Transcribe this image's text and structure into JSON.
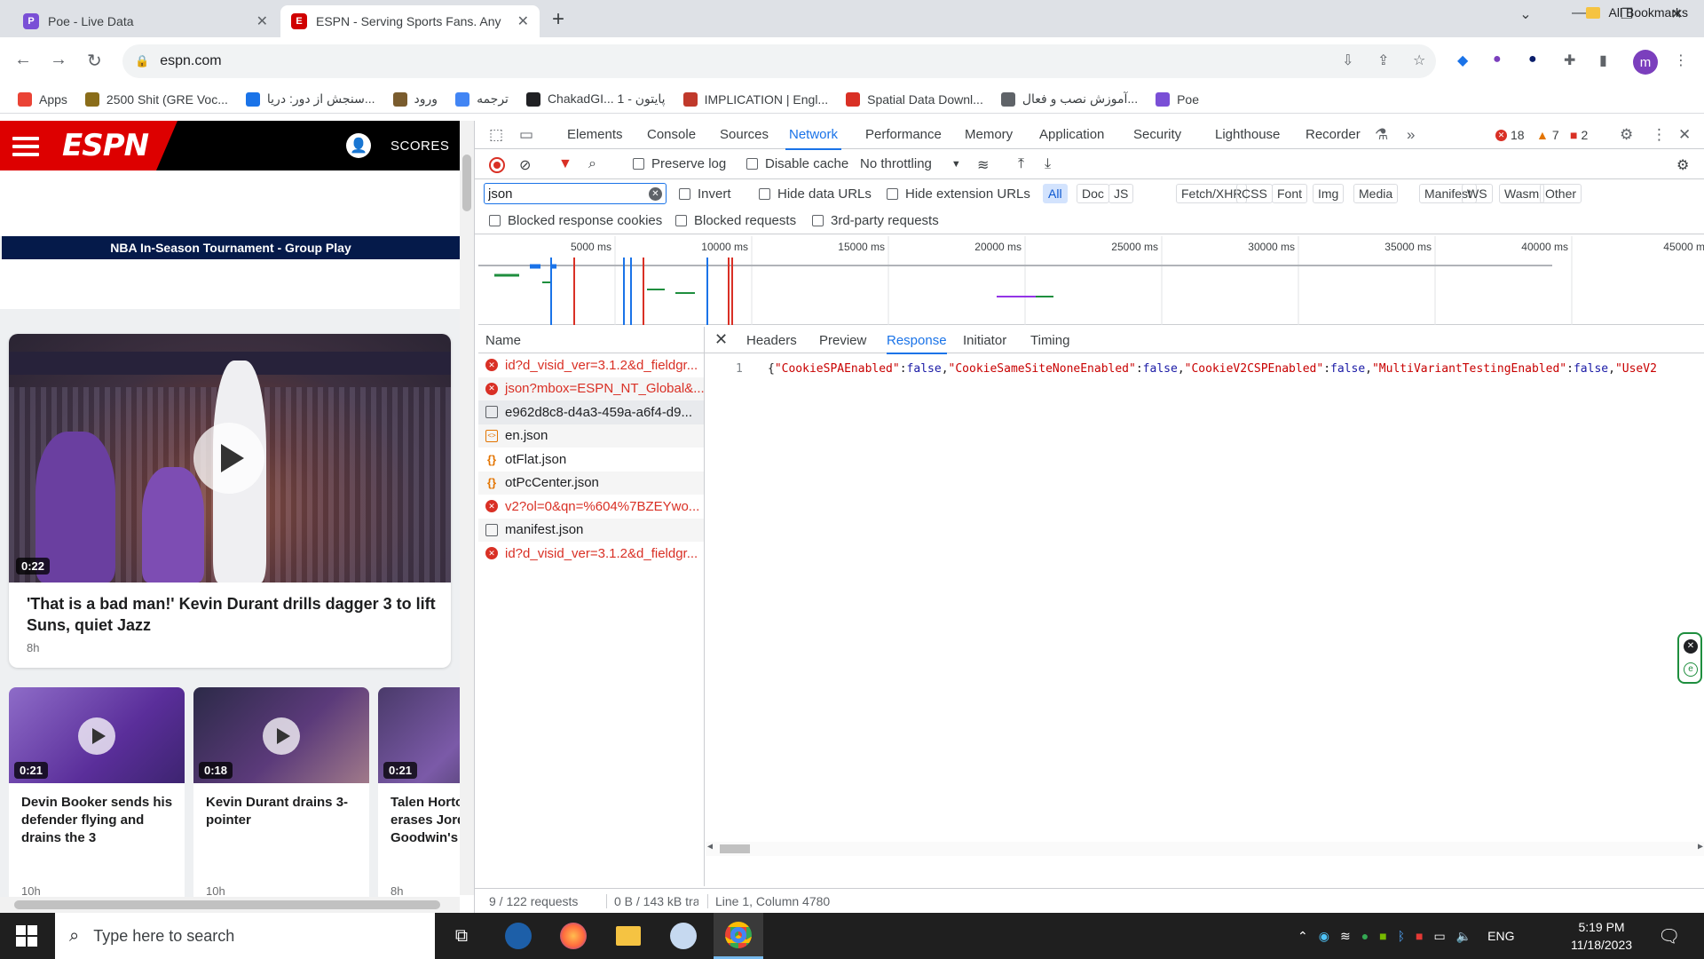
{
  "browser": {
    "tabs": [
      {
        "title": "Poe - Live Data",
        "favicon_color": "#7a4fd6"
      },
      {
        "title": "ESPN - Serving Sports Fans. Any",
        "favicon_color": "#d00000"
      }
    ],
    "url": "espn.com",
    "profile_initial": "m"
  },
  "bookmarks": [
    {
      "label": "Apps",
      "icon": "apps-grid-icon",
      "color": "#ea4335"
    },
    {
      "label": "2500 Shit (GRE Voc...",
      "icon": "gre-icon",
      "color": "#8a6d1a"
    },
    {
      "label": "سنجش از دور: دریا...",
      "icon": "globe-icon",
      "color": "#1a73e8"
    },
    {
      "label": "ورود",
      "icon": "login-icon",
      "color": "#7a5c2e"
    },
    {
      "label": "ترجمه",
      "icon": "translate-icon",
      "color": "#4285f4"
    },
    {
      "label": "ChakadGI... پایتون - 1",
      "icon": "chakad-icon",
      "color": "#202124"
    },
    {
      "label": "IMPLICATION | Engl...",
      "icon": "cambridge-icon",
      "color": "#c0392b"
    },
    {
      "label": "Spatial Data Downl...",
      "icon": "spatial-icon",
      "color": "#d93025"
    },
    {
      "label": "آموزش نصب و فعال...",
      "icon": "globe-icon",
      "color": "#5f6368"
    },
    {
      "label": "Poe",
      "icon": "poe-icon",
      "color": "#7a4fd6"
    }
  ],
  "all_bookmarks": "All Bookmarks",
  "espn": {
    "logo": "ESPN",
    "scores": "SCORES",
    "banner": "NBA In-Season Tournament - Group Play",
    "hero": {
      "duration": "0:22",
      "title": "'That is a bad man!' Kevin Durant drills dagger 3 to lift Suns, quiet Jazz",
      "time": "8h"
    },
    "minis": [
      {
        "duration": "0:21",
        "title": "Devin Booker sends his defender flying and drains the 3",
        "time": "10h"
      },
      {
        "duration": "0:18",
        "title": "Kevin Durant drains 3-pointer",
        "time": "10h"
      },
      {
        "duration": "0:21",
        "title": "Talen Horton-Tucker erases Jordan Goodwin's attempt",
        "time": "8h"
      }
    ]
  },
  "devtools": {
    "tabs": [
      "Elements",
      "Console",
      "Sources",
      "Network",
      "Performance",
      "Memory",
      "Application",
      "Security",
      "Lighthouse",
      "Recorder"
    ],
    "active_tab": "Network",
    "errors": "18",
    "warnings": "7",
    "issues": "2",
    "preserve_log": "Preserve log",
    "disable_cache": "Disable cache",
    "throttling": "No throttling",
    "filter_value": "json",
    "invert": "Invert",
    "hide_data_urls": "Hide data URLs",
    "hide_extension_urls": "Hide extension URLs",
    "type_filters": [
      "All",
      "Doc",
      "JS",
      "Fetch/XHR",
      "CSS",
      "Font",
      "Img",
      "Media",
      "Manifest",
      "WS",
      "Wasm",
      "Other"
    ],
    "active_type": "All",
    "blocked_cookies": "Blocked response cookies",
    "blocked_requests": "Blocked requests",
    "third_party": "3rd-party requests",
    "timeline_ticks": [
      "5000 ms",
      "10000 ms",
      "15000 ms",
      "20000 ms",
      "25000 ms",
      "30000 ms",
      "35000 ms",
      "40000 ms",
      "45000 m"
    ],
    "name_header": "Name",
    "detail_tabs": [
      "Headers",
      "Preview",
      "Response",
      "Initiator",
      "Timing"
    ],
    "active_detail_tab": "Response",
    "requests": [
      {
        "name": "id?d_visid_ver=3.1.2&d_fieldgr...",
        "type": "error"
      },
      {
        "name": "json?mbox=ESPN_NT_Global&...",
        "type": "error"
      },
      {
        "name": "e962d8c8-d4a3-459a-a6f4-d9...",
        "type": "doc",
        "selected": true
      },
      {
        "name": "en.json",
        "type": "json"
      },
      {
        "name": "otFlat.json",
        "type": "braces"
      },
      {
        "name": "otPcCenter.json",
        "type": "braces"
      },
      {
        "name": "v2?ol=0&qn=%604%7BZEYwo...",
        "type": "error"
      },
      {
        "name": "manifest.json",
        "type": "doc"
      },
      {
        "name": "id?d_visid_ver=3.1.2&d_fieldgr...",
        "type": "error"
      }
    ],
    "response_line_number": "1",
    "response_text": "{\"CookieSPAEnabled\":false,\"CookieSameSiteNoneEnabled\":false,\"CookieV2CSPEnabled\":false,\"MultiVariantTestingEnabled\":false,\"UseV2",
    "status_requests": "9 / 122 requests",
    "status_transfer": "0 B / 143 kB trai",
    "status_cursor": "Line 1, Column 4780"
  },
  "taskbar": {
    "search_placeholder": "Type here to search",
    "language": "ENG",
    "time": "5:19 PM",
    "date": "11/18/2023"
  }
}
